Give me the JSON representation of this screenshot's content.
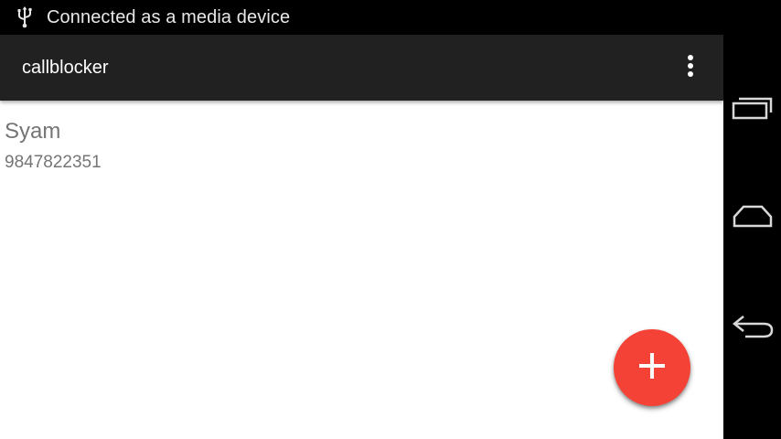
{
  "status_bar": {
    "notification_icon": "usb-icon",
    "text": "Connected as a media device"
  },
  "toolbar": {
    "title": "callblocker",
    "menu_icon": "overflow-menu-icon"
  },
  "contacts": [
    {
      "name": "Syam",
      "number": "9847822351"
    }
  ],
  "fab": {
    "icon": "add-icon",
    "color": "#f44336"
  },
  "nav_bar": {
    "buttons": [
      "recent-apps-icon",
      "home-icon",
      "back-icon"
    ]
  },
  "colors": {
    "toolbar": "#212121",
    "status_bar": "#000000",
    "content_bg": "#ffffff",
    "secondary_text": "#757575"
  }
}
